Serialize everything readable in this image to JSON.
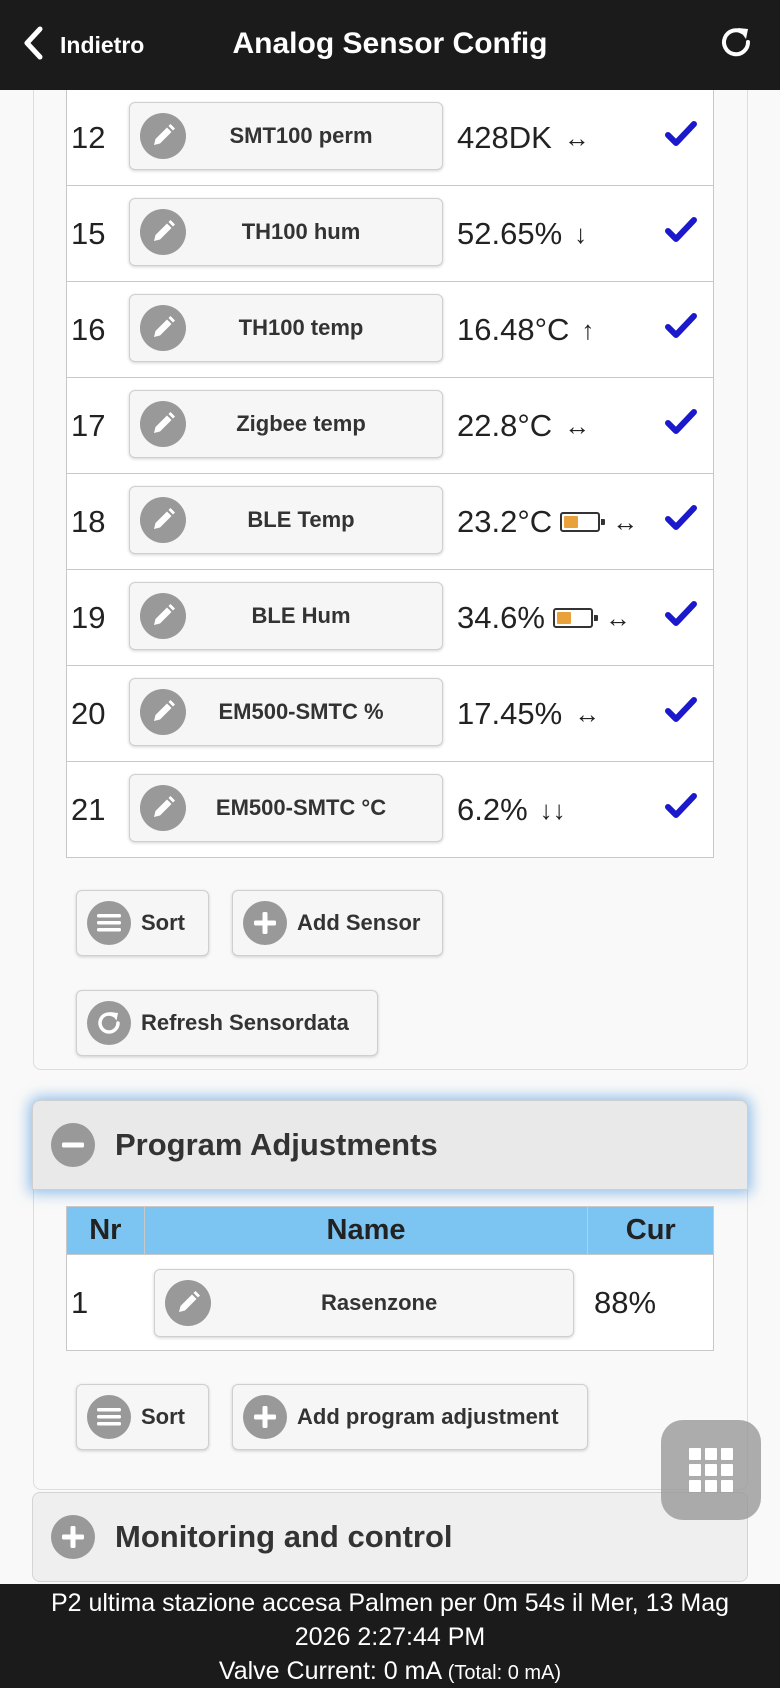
{
  "header": {
    "back_label": "Indietro",
    "title": "Analog Sensor Config"
  },
  "sensors": [
    {
      "nr": "12",
      "name": "SMT100 perm",
      "value": "428DK",
      "battery": null,
      "trend": "↔"
    },
    {
      "nr": "15",
      "name": "TH100 hum",
      "value": "52.65%",
      "battery": null,
      "trend": "↓"
    },
    {
      "nr": "16",
      "name": "TH100 temp",
      "value": "16.48°C",
      "battery": null,
      "trend": "↑"
    },
    {
      "nr": "17",
      "name": "Zigbee temp",
      "value": "22.8°C",
      "battery": null,
      "trend": "↔"
    },
    {
      "nr": "18",
      "name": "BLE Temp",
      "value": "23.2°C",
      "battery": 0.4,
      "trend": "↔"
    },
    {
      "nr": "19",
      "name": "BLE Hum",
      "value": "34.6%",
      "battery": 0.4,
      "trend": "↔"
    },
    {
      "nr": "20",
      "name": "EM500-SMTC %",
      "value": "17.45%",
      "battery": null,
      "trend": "↔"
    },
    {
      "nr": "21",
      "name": "EM500-SMTC °C",
      "value": "6.2%",
      "battery": null,
      "trend": "↓↓"
    }
  ],
  "sensor_buttons": {
    "sort_label": "Sort",
    "add_label": "Add Sensor",
    "refresh_label": "Refresh Sensordata"
  },
  "program_adjustments": {
    "title": "Program Adjustments",
    "columns": [
      "Nr",
      "Name",
      "Cur"
    ],
    "rows": [
      {
        "nr": "1",
        "name": "Rasenzone",
        "cur": "88%"
      }
    ],
    "sort_label": "Sort",
    "add_label": "Add program adjustment"
  },
  "monitoring": {
    "title": "Monitoring and control"
  },
  "footer": {
    "line1": "P2 ultima stazione accesa Palmen per 0m 54s il Mer, 13 Mag",
    "line2": "2026 2:27:44 PM",
    "valve_label": "Valve Current: 0 mA",
    "valve_total": "(Total: 0 mA)"
  },
  "colors": {
    "header_bg": "#1b1b1b",
    "table_header_bg": "#7cc4f2",
    "check": "#1a1acc",
    "battery_fill": "#e9a23b",
    "focus_glow": "#388cdc"
  }
}
